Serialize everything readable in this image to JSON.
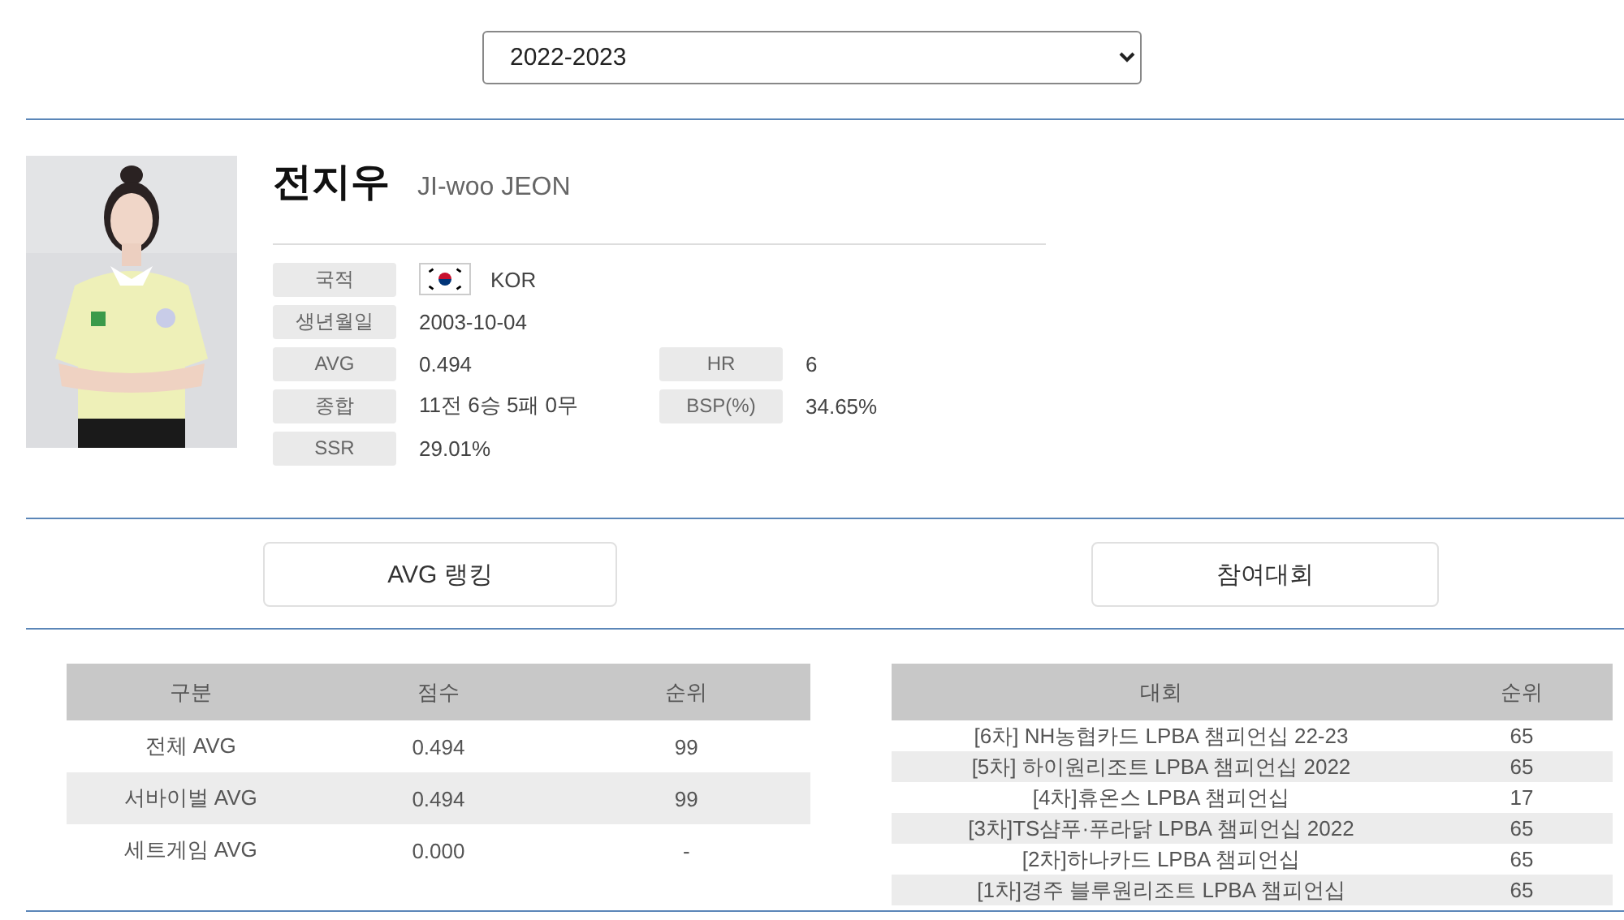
{
  "season_select": {
    "value": "2022-2023"
  },
  "player": {
    "photo": {
      "kind": "picture"
    },
    "name_ko": "전지우",
    "name_en": "JI-woo JEON",
    "info_rows": [
      [
        {
          "label": "국적",
          "value": "KOR",
          "kind": "flag"
        }
      ],
      [
        {
          "label": "생년월일",
          "value": "2003-10-04",
          "kind": "text"
        }
      ],
      [
        {
          "label": "AVG",
          "value": "0.494",
          "kind": "text"
        },
        {
          "label": "HR",
          "value": "6",
          "kind": "text"
        }
      ],
      [
        {
          "label": "종합",
          "value": "11전 6승 5패 0무",
          "kind": "text"
        },
        {
          "label": "BSP(%)",
          "value": "34.65%",
          "kind": "text"
        }
      ],
      [
        {
          "label": "SSR",
          "value": "29.01%",
          "kind": "text"
        }
      ]
    ]
  },
  "section_buttons": [
    "AVG 랭킹",
    "참여대회"
  ],
  "avg_table": {
    "columns": [
      "구분",
      "점수",
      "순위"
    ],
    "rows": [
      [
        "전체 AVG",
        "0.494",
        "99"
      ],
      [
        "서바이벌 AVG",
        "0.494",
        "99"
      ],
      [
        "세트게임 AVG",
        "0.000",
        "-"
      ]
    ]
  },
  "tournament_table": {
    "columns": [
      "대회",
      "순위"
    ],
    "rows": [
      [
        "[6차] NH농협카드 LPBA 챔피언십 22-23",
        "65"
      ],
      [
        "[5차] 하이원리조트 LPBA 챔피언십 2022",
        "65"
      ],
      [
        "[4차]휴온스 LPBA 챔피언십",
        "17"
      ],
      [
        "[3차]TS샴푸·푸라닭 LPBA 챔피언십 2022",
        "65"
      ],
      [
        "[2차]하나카드 LPBA 챔피언십",
        "65"
      ],
      [
        "[1차]경주 블루원리조트 LPBA 챔피언십",
        "65"
      ]
    ]
  }
}
